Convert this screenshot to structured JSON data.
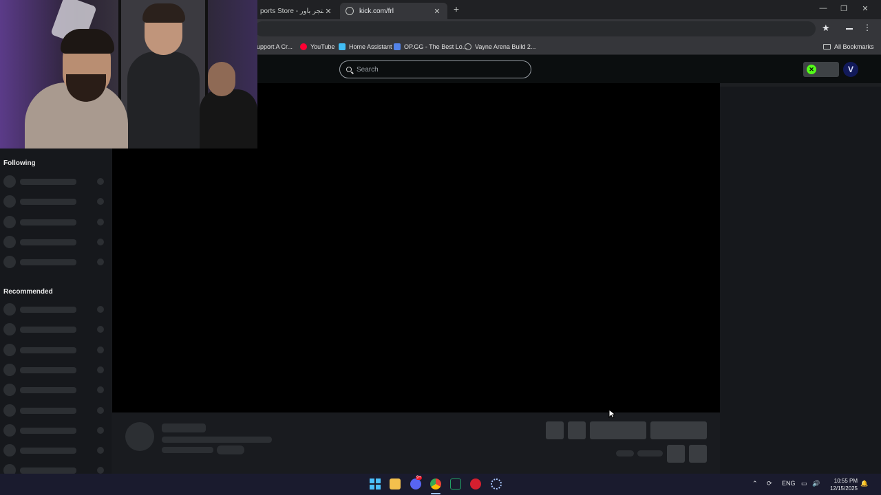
{
  "browser": {
    "tabs": [
      {
        "label": "ports Store - لوحة - متجر باور",
        "active": false
      },
      {
        "label": "kick.com/frl",
        "active": true
      }
    ],
    "bookmarks": [
      {
        "label": "upport A Cr...",
        "icon": "bookmark-icon"
      },
      {
        "label": "YouTube",
        "icon": "youtube-icon"
      },
      {
        "label": "Home Assistant",
        "icon": "home-assistant-icon"
      },
      {
        "label": "OP.GG - The Best Lo...",
        "icon": "opgg-icon"
      },
      {
        "label": "Vayne Arena Build 2...",
        "icon": "globe-icon"
      }
    ],
    "all_bookmarks_label": "All Bookmarks"
  },
  "kick": {
    "search_placeholder": "Search",
    "accent": "#53fc18",
    "sidebar": {
      "following_title": "Following",
      "recommended_title": "Recommended",
      "following_count": 5,
      "recommended_count": 9
    }
  },
  "taskbar": {
    "apps": [
      "start-icon",
      "file-explorer-icon",
      "discord-icon",
      "chrome-icon",
      "excel-icon",
      "red-app-icon",
      "settings-icon"
    ],
    "discord_badge": "9+",
    "language": "ENG",
    "time": "10:55 PM",
    "date": "12/15/2025"
  }
}
